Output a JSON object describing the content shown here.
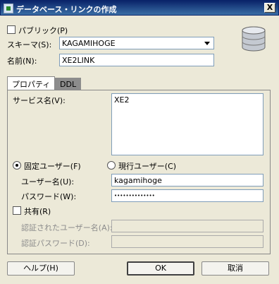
{
  "window": {
    "title": "データベース・リンクの作成",
    "close_label": "X"
  },
  "form": {
    "public_label": "パブリック(P)",
    "schema_label": "スキーマ(S):",
    "schema_value": "KAGAMIHOGE",
    "name_label": "名前(N):",
    "name_value": "XE2LINK"
  },
  "tabs": [
    {
      "label": "プロパティ",
      "active": true
    },
    {
      "label": "DDL",
      "active": false
    }
  ],
  "properties": {
    "service_label": "サービス名(V):",
    "service_value": "XE2",
    "fixed_user_label": "固定ユーザー(F)",
    "current_user_label": "現行ユーザー(C)",
    "selected_mode": "fixed_user",
    "username_label": "ユーザー名(U):",
    "username_value": "kagamihoge",
    "password_label": "パスワード(W):",
    "password_value": "••••••••••••••",
    "shared_label": "共有(R)",
    "auth_user_label": "認証されたユーザー名(A):",
    "auth_password_label": "認証パスワード(D):"
  },
  "buttons": {
    "help": "ヘルプ(H)",
    "ok": "OK",
    "cancel": "取消"
  },
  "colors": {
    "dialog_bg": "#ece9d8",
    "title_bar": "#0a246a"
  },
  "icons": {
    "title": "database-link-icon",
    "schema": "database-icon"
  }
}
